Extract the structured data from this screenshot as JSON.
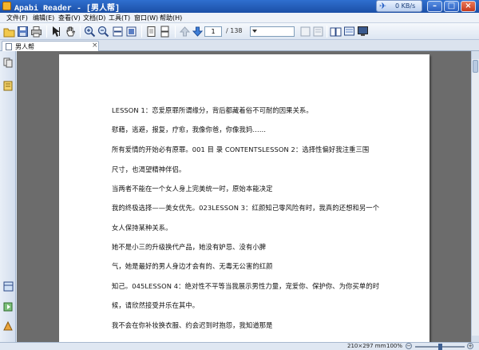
{
  "window": {
    "title": "Apabi Reader - [男人帮]",
    "network_speed": "0 KB/s",
    "minimize_glyph": "–",
    "maximize_glyph": "□",
    "close_glyph": "×"
  },
  "menu": [
    {
      "label": "文件(F)"
    },
    {
      "label": "编辑(E)"
    },
    {
      "label": "查看(V)"
    },
    {
      "label": "文档(D)"
    },
    {
      "label": "工具(T)"
    },
    {
      "label": "窗口(W)"
    },
    {
      "label": "帮助(H)"
    }
  ],
  "toolbar": {
    "current_page": "1",
    "total_pages": "/ 138",
    "icons": [
      "open-icon",
      "save-icon",
      "print-icon",
      "select-cursor-icon",
      "hand-tool-icon",
      "zoom-in-icon",
      "zoom-out-icon",
      "fit-width-icon",
      "fit-page-icon",
      "single-page-icon",
      "continuous-page-icon",
      "prev-page-arrow-icon",
      "next-page-arrow-icon",
      "bookmark-icon",
      "annotation-icon",
      "book-view-icon",
      "thumbnail-icon",
      "fullscreen-icon"
    ]
  },
  "tab": {
    "label": "男人帮",
    "close_glyph": "×"
  },
  "document": {
    "paragraphs": [
      "LESSON 1：恋爱原罪所谓缘分，背后都藏着俗不可耐的因果关系。",
      "慰藉，逃避，报复，疗愈，我像你爸，你像我妈……",
      "所有爱情的开始必有原罪。001 目          录 CONTENTSLESSON 2：选择性偏好我注重三围",
      "尺寸，也渴望精神伴侣。",
      "当两者不能在一个女人身上完美统一时，原始本能决定",
      "我的终极选择——美女优先。023LESSON 3：红颜知己零风险有时，我真的还想和另一个",
      "女人保持某种关系。",
      "她不是小三的升级换代产品，她没有妒忌、没有小脾",
      "气，她是最好的男人身边才会有的、无毒无公害的红颜",
      "知己。045LESSON 4：绝对性不平等当我展示男性力量，宠爱你、保护你、为你买单的时",
      "候，请欣然接受并乐在其中。",
      "我不会在你补妆换衣服、约会迟到时抱怨，我知道那是"
    ]
  },
  "statusbar": {
    "page_size": "210×297 mm",
    "zoom": "100%",
    "zoom_minus": "−",
    "zoom_plus": "+",
    "zoom_slider_level": 0.5
  }
}
